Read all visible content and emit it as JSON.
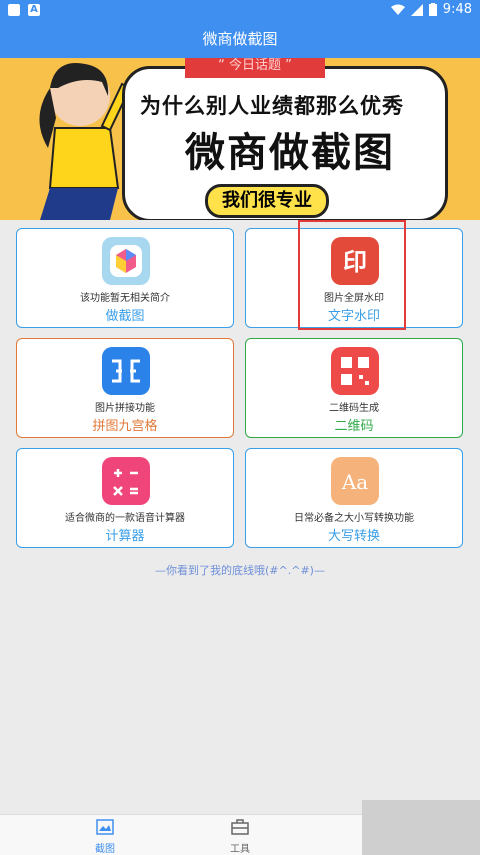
{
  "status_bar": {
    "time": "9:48",
    "notification_icon": "A"
  },
  "app_bar": {
    "title": "微商做截图"
  },
  "banner": {
    "ribbon_text": "“ 今日话题 ”",
    "headline": "为什么别人业绩都那么优秀",
    "title": "微商做截图",
    "tag": "我们很专业"
  },
  "tools": [
    {
      "desc": "该功能暂无相关简介",
      "name": "做截图",
      "accent": "#3a9ee8",
      "icon": "cube-app-icon"
    },
    {
      "desc": "图片全屏水印",
      "name": "文字水印",
      "accent": "#3a9ee8",
      "icon": "print-stamp-icon"
    },
    {
      "desc": "图片拼接功能",
      "name": "拼图九宫格",
      "accent": "#e07a3a",
      "icon": "split-icon"
    },
    {
      "desc": "二维码生成",
      "name": "二维码",
      "accent": "#2eaa4a",
      "icon": "qr-code-icon"
    },
    {
      "desc": "适合微商的一款语音计算器",
      "name": "计算器",
      "accent": "#3a9ee8",
      "icon": "calculator-icon"
    },
    {
      "desc": "日常必备之大小写转换功能",
      "name": "大写转换",
      "accent": "#3a9ee8",
      "icon": "font-case-icon"
    }
  ],
  "footer_note": "—你看到了我的底线哦(#^.^#)—",
  "bottom_nav": [
    {
      "label": "截图",
      "active": true,
      "icon": "image-icon"
    },
    {
      "label": "工具",
      "active": false,
      "icon": "toolbox-icon"
    }
  ],
  "colors": {
    "primary": "#3f8ff0",
    "highlight": "#e23b3b"
  }
}
